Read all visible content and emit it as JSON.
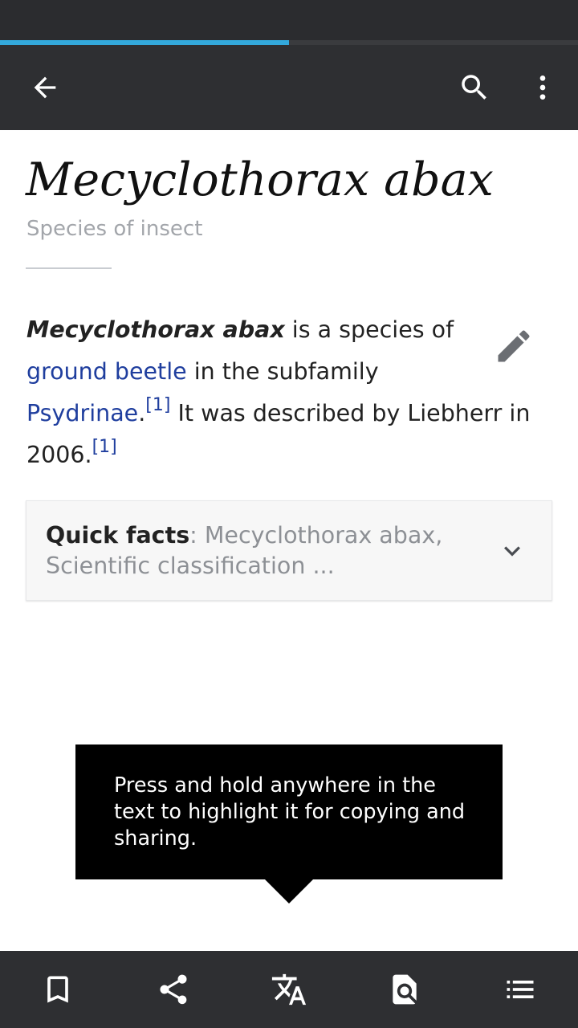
{
  "page": {
    "load_progress": 0.5
  },
  "colors": {
    "toolbar": "#2e2f32",
    "progress": "#33a9dc",
    "link": "#1f3e9e",
    "tooltip": "#000000"
  },
  "toolbar": {
    "icons": [
      "back-arrow-icon",
      "search-icon",
      "more-vert-icon"
    ]
  },
  "article": {
    "title": "Mecyclothorax abax",
    "description": "Species of insect",
    "lead": {
      "bold_term": "Mecyclothorax abax",
      "text_1": " is a species of ",
      "link_1": "ground beetle",
      "text_2": " in the subfamily ",
      "link_2": "Psydrinae",
      "text_3": ".",
      "ref_1": "[1]",
      "text_4": " It was described by Liebherr in 2006.",
      "ref_2": "[1]"
    }
  },
  "quick_facts": {
    "label": "Quick facts",
    "separator": ": ",
    "summary": "Mecyclothorax abax, Scientific classification ..."
  },
  "tooltip": {
    "text": "Press and hold anywhere in the text to highlight it for copying and sharing."
  },
  "bottom_bar": {
    "icons": [
      "bookmark-icon",
      "share-icon",
      "translate-icon",
      "find-in-page-icon",
      "table-of-contents-icon"
    ]
  }
}
